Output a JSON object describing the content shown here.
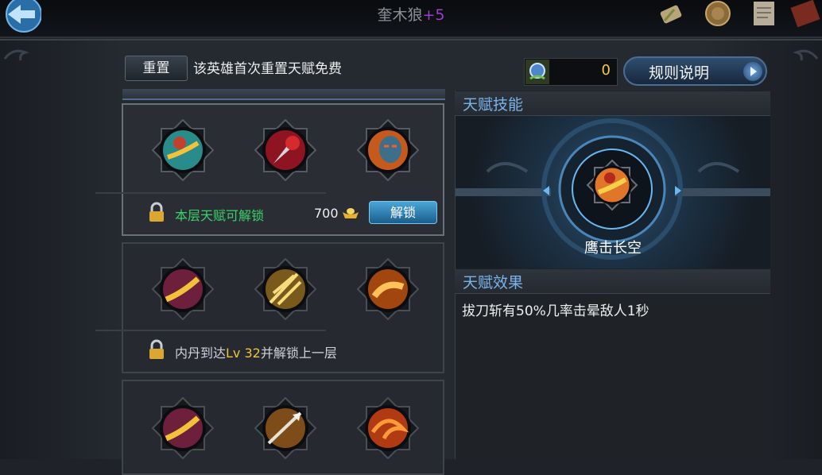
{
  "header": {
    "hero_name": "奎木狼",
    "hero_plus": "+5"
  },
  "toolbar": {
    "reset_label": "重置",
    "reset_note": "该英雄首次重置天赋免费",
    "currency_value": "0",
    "rules_label": "规则说明"
  },
  "tiers": [
    {
      "status": "本层天赋可解锁",
      "cost": "700",
      "unlock_label": "解锁",
      "skills": [
        "dragon-slash",
        "crimson-blade",
        "berserker-face"
      ]
    },
    {
      "status_prefix": "内丹到达",
      "status_level": "Lv 32",
      "status_suffix": "并解锁上一层",
      "skills": [
        "gold-slash",
        "radiant-strike",
        "fire-strike"
      ]
    },
    {
      "skills": [
        "gold-slash",
        "spear-strike",
        "flame-swirl"
      ]
    }
  ],
  "talent_skill": {
    "heading": "天赋技能",
    "name": "鹰击长空"
  },
  "talent_effect": {
    "heading": "天赋效果",
    "text": "拔刀斩有50%几率击晕敌人1秒"
  },
  "colors": {
    "status_unlockable": "#39d26a",
    "level_highlight": "#f0c53a",
    "section_heading": "#79b3ea",
    "hero_plus": "#9b3fc9",
    "currency": "#f4cc3f"
  }
}
